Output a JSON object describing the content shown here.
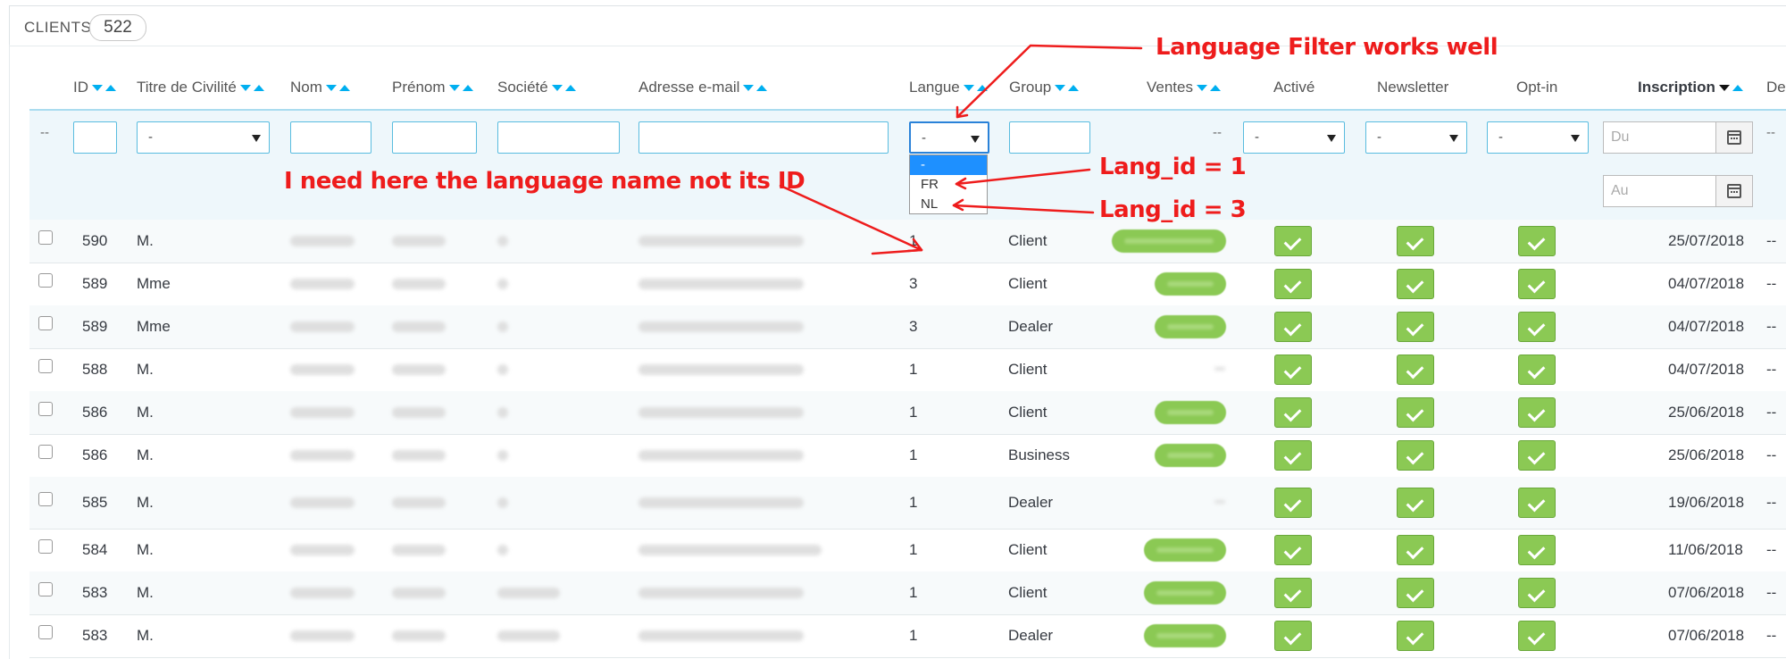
{
  "panel": {
    "title": "CLIENTS",
    "count": "522"
  },
  "columns": {
    "id": "ID",
    "civility": "Titre de Civilité",
    "lastname": "Nom",
    "firstname": "Prénom",
    "company": "Société",
    "email": "Adresse e-mail",
    "language": "Langue",
    "group": "Group",
    "sales": "Ventes",
    "active": "Activé",
    "newsletter": "Newsletter",
    "optin": "Opt-in",
    "signup": "Inscription",
    "last": "De"
  },
  "filters": {
    "leading_dash": "--",
    "civility": "-",
    "language": "-",
    "sales_dash": "--",
    "active": "-",
    "newsletter": "-",
    "optin": "-",
    "date_from_placeholder": "Du",
    "date_to_placeholder": "Au",
    "trailing_dash": "--"
  },
  "language_dropdown": {
    "options": [
      "-",
      "FR",
      "NL"
    ],
    "selected": "-"
  },
  "annotations": {
    "filter_works": "Language Filter works well",
    "need_name": "I need here the language name not its ID",
    "lang1": "Lang_id = 1",
    "lang3": "Lang_id = 3",
    "color": "#ee1c1c"
  },
  "rows": [
    {
      "id": "590",
      "civility": "M.",
      "language": "1",
      "group": "Client",
      "date": "25/07/2018",
      "trail": "--"
    },
    {
      "id": "589",
      "civility": "Mme",
      "language": "3",
      "group": "Client",
      "date": "04/07/2018",
      "trail": "--"
    },
    {
      "id": "589",
      "civility": "Mme",
      "language": "3",
      "group": "Dealer",
      "date": "04/07/2018",
      "trail": "--"
    },
    {
      "id": "588",
      "civility": "M.",
      "language": "1",
      "group": "Client",
      "date": "04/07/2018",
      "trail": "--"
    },
    {
      "id": "586",
      "civility": "M.",
      "language": "1",
      "group": "Client",
      "date": "25/06/2018",
      "trail": "--"
    },
    {
      "id": "586",
      "civility": "M.",
      "language": "1",
      "group": "Business",
      "date": "25/06/2018",
      "trail": "--"
    },
    {
      "id": "585",
      "civility": "M.",
      "language": "1",
      "group": "Dealer",
      "date": "19/06/2018",
      "trail": "--"
    },
    {
      "id": "584",
      "civility": "M.",
      "language": "1",
      "group": "Client",
      "date": "11/06/2018",
      "trail": "--"
    },
    {
      "id": "583",
      "civility": "M.",
      "language": "1",
      "group": "Client",
      "date": "07/06/2018",
      "trail": "--"
    },
    {
      "id": "583",
      "civility": "M.",
      "language": "1",
      "group": "Dealer",
      "date": "07/06/2018",
      "trail": "--"
    }
  ],
  "colors": {
    "accent": "#00aff0",
    "check_green": "#8bc954",
    "filter_bg": "#eef7fb"
  }
}
